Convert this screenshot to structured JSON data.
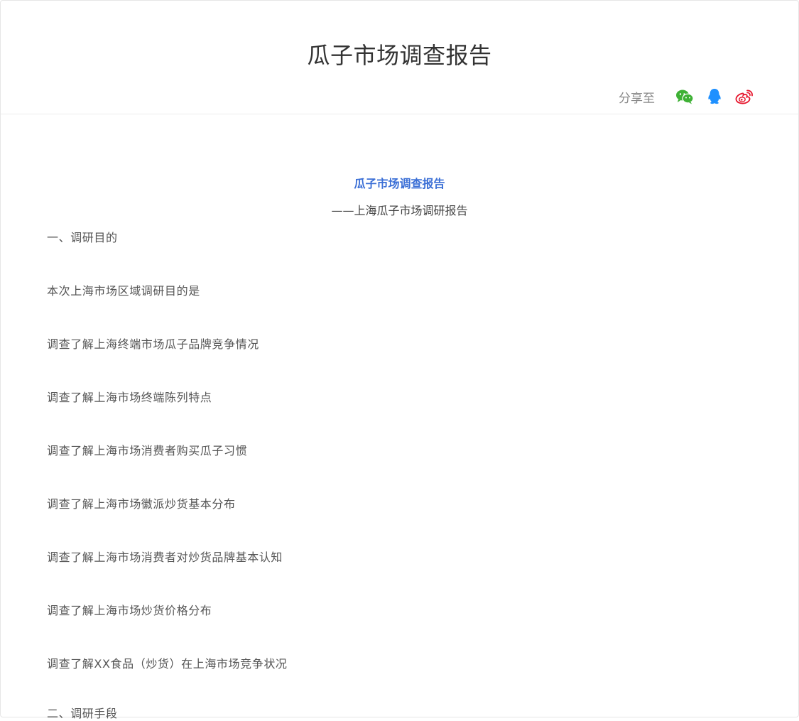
{
  "header": {
    "title": "瓜子市场调查报告",
    "share_label": "分享至",
    "share_icons": [
      "wechat-icon",
      "qq-icon",
      "weibo-icon"
    ]
  },
  "colors": {
    "accent_blue": "#3b6fd6",
    "wechat_green": "#3eb135",
    "qq_blue": "#1e90ff",
    "weibo_red": "#e6162d"
  },
  "document": {
    "title": "瓜子市场调查报告",
    "subtitle": "——上海瓜子市场调研报告",
    "paragraphs": [
      "一、调研目的",
      "本次上海市场区域调研目的是",
      "调查了解上海终端市场瓜子品牌竞争情况",
      "调查了解上海市场终端陈列特点",
      "调查了解上海市场消费者购买瓜子习惯",
      "调查了解上海市场徽派炒货基本分布",
      "调查了解上海市场消费者对炒货品牌基本认知",
      "调查了解上海市场炒货价格分布",
      "调查了解XX食品（炒货）在上海市场竞争状况",
      "二、调研手段"
    ]
  }
}
